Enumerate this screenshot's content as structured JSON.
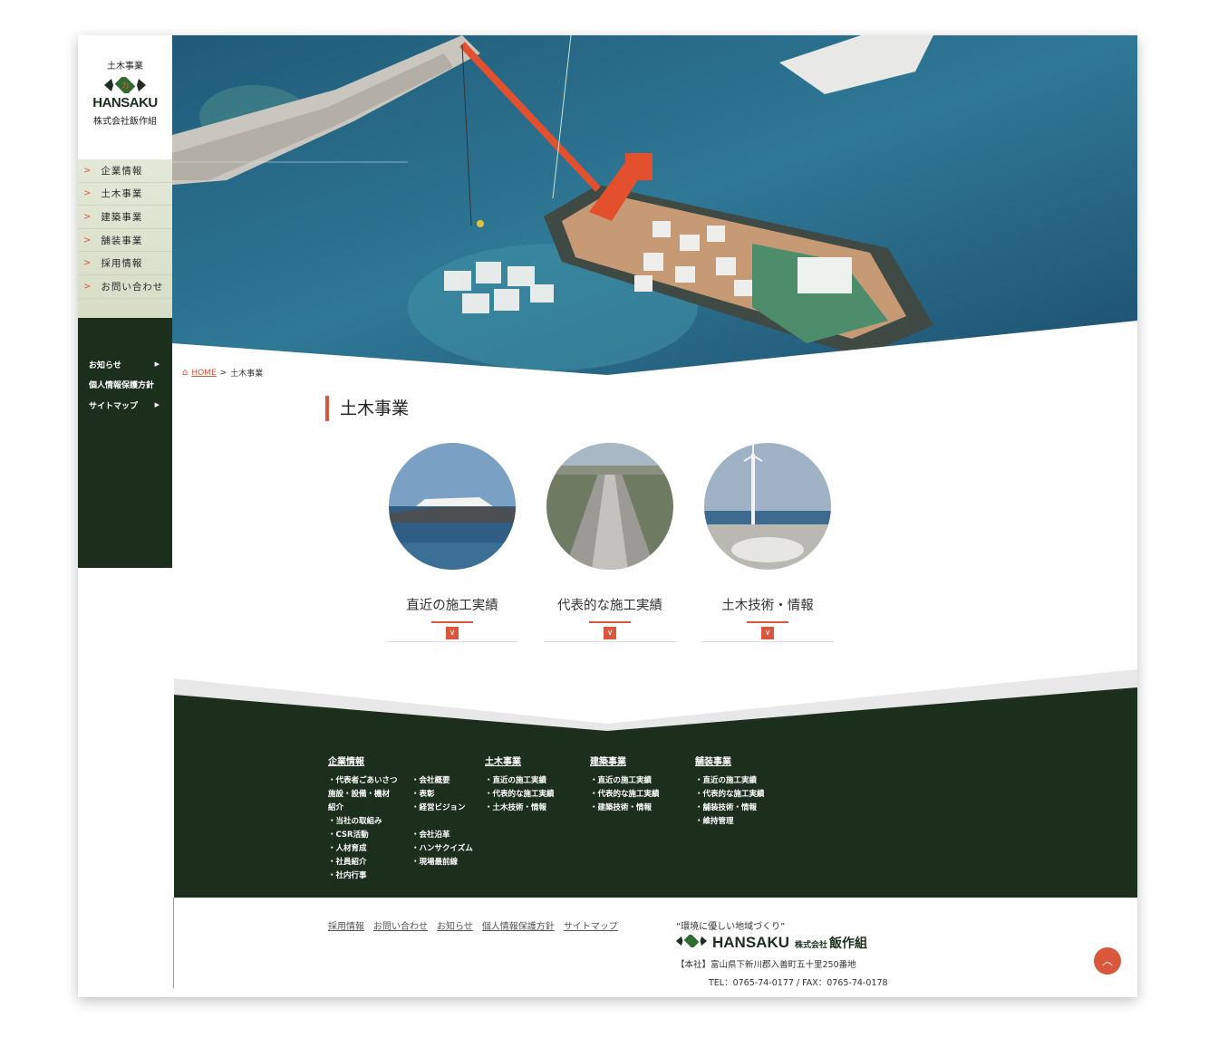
{
  "logo": {
    "category": "土木事業",
    "wordmark": "HANSAKU",
    "company": "株式会社飯作組"
  },
  "menu": [
    {
      "label": "企業情報"
    },
    {
      "label": "土木事業"
    },
    {
      "label": "建築事業"
    },
    {
      "label": "舗装事業"
    },
    {
      "label": "採用情報"
    },
    {
      "label": "お問い合わせ"
    }
  ],
  "subnav": [
    {
      "label": "お知らせ"
    },
    {
      "label": "個人情報保護方針"
    },
    {
      "label": "サイトマップ"
    }
  ],
  "breadcrumb": {
    "home": "HOME",
    "sep": ">",
    "current": "土木事業"
  },
  "page_title": "土木事業",
  "cards": [
    {
      "label": "直近の施工実績"
    },
    {
      "label": "代表的な施工実績"
    },
    {
      "label": "土木技術・情報"
    }
  ],
  "footer": {
    "cols": [
      {
        "title": "企業情報",
        "left": [
          "・代表者ごあいさつ",
          "施設・設備・機材",
          "紹介",
          "・当社の取組み",
          "・CSR活動",
          "・人材育成",
          "・社員紹介",
          "・社内行事"
        ],
        "right": [
          "・会社概要",
          "・表彰",
          "・経営ビジョン",
          "",
          "・会社沿革",
          "・ハンサクイズム",
          "・現場最前線"
        ]
      },
      {
        "title": "土木事業",
        "items": [
          "・直近の施工実績",
          "・代表的な施工実績",
          "・土木技術・情報"
        ]
      },
      {
        "title": "建築事業",
        "items": [
          "・直近の施工実績",
          "・代表的な施工実績",
          "・建築技術・情報"
        ]
      },
      {
        "title": "舗装事業",
        "items": [
          "・直近の施工実績",
          "・代表的な施工実績",
          "・舗装技術・情報",
          "・維持管理"
        ]
      }
    ],
    "links": [
      "採用情報",
      "お問い合わせ",
      "お知らせ",
      "個人情報保護方針",
      "サイトマップ"
    ],
    "slogan": "“環境に優しい地域づくり”",
    "brand_word": "HANSAKU",
    "brand_kk": "株式会社",
    "brand_name": "飯作組",
    "address": "【本社】富山県下新川郡入善町五十里250番地",
    "tel": "TEL：0765-74-0177 / FAX：0765-74-0178"
  },
  "icons": {
    "home": "home-icon",
    "chevron": "chevron-right-icon",
    "arrow_up": "arrow-up-icon",
    "chevron_down": "chevron-down-icon"
  },
  "colors": {
    "accent": "#d9573c",
    "dark_green": "#1c2e1c",
    "sea": "#2f6f8e"
  }
}
